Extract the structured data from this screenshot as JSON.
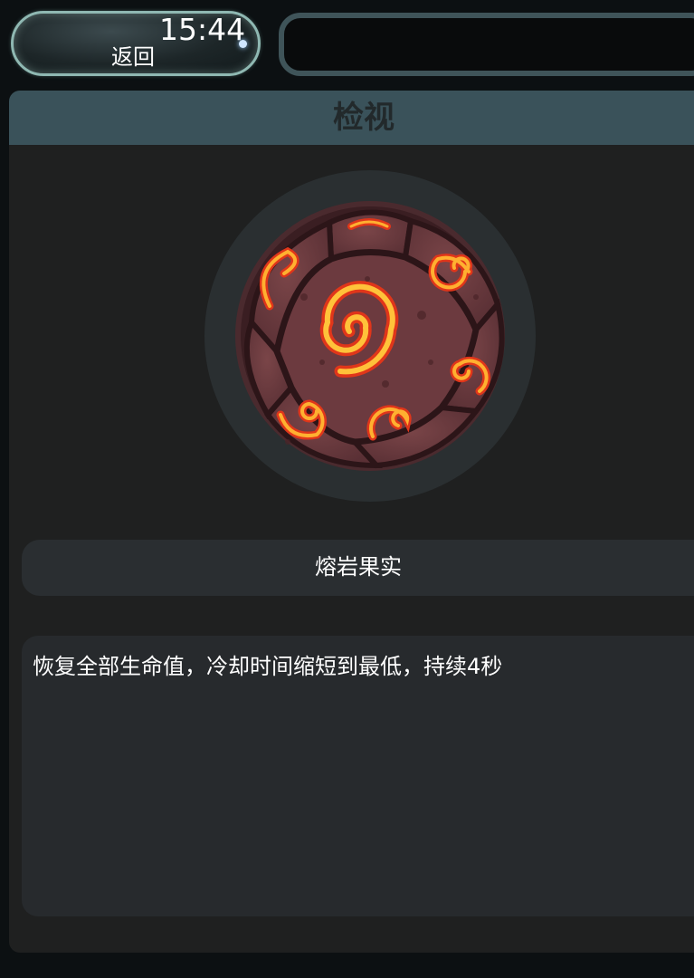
{
  "status_bar": {
    "time": "15:44"
  },
  "nav": {
    "back_label": "返回"
  },
  "panel": {
    "title": "检视"
  },
  "item": {
    "name": "熔岩果实",
    "description": "恢复全部生命值，冷却时间缩短到最低，持续4秒",
    "icon": "lava-fruit-icon"
  },
  "colors": {
    "panel_header": "#3a525a",
    "panel_bg": "#1f2020",
    "fruit_body": "#6a3b3e",
    "fruit_swirl": "#f5a020"
  }
}
